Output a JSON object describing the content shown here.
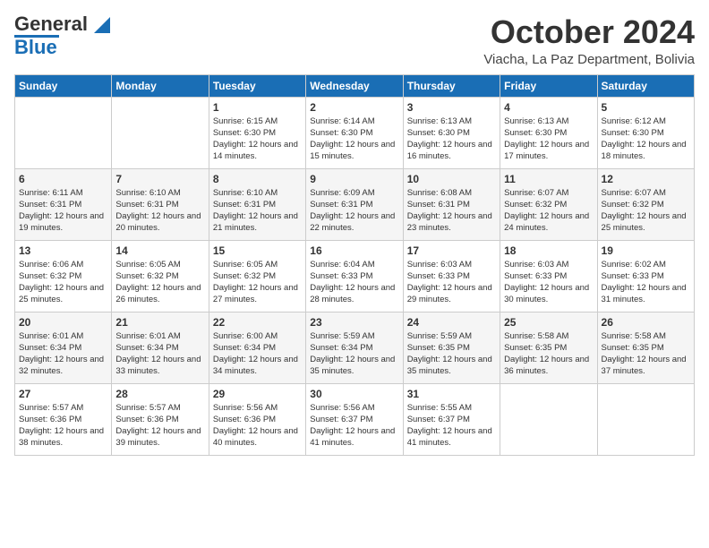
{
  "header": {
    "logo_general": "General",
    "logo_blue": "Blue",
    "month": "October 2024",
    "location": "Viacha, La Paz Department, Bolivia"
  },
  "days_of_week": [
    "Sunday",
    "Monday",
    "Tuesday",
    "Wednesday",
    "Thursday",
    "Friday",
    "Saturday"
  ],
  "weeks": [
    [
      {
        "day": "",
        "sunrise": "",
        "sunset": "",
        "daylight": ""
      },
      {
        "day": "",
        "sunrise": "",
        "sunset": "",
        "daylight": ""
      },
      {
        "day": "1",
        "sunrise": "Sunrise: 6:15 AM",
        "sunset": "Sunset: 6:30 PM",
        "daylight": "Daylight: 12 hours and 14 minutes."
      },
      {
        "day": "2",
        "sunrise": "Sunrise: 6:14 AM",
        "sunset": "Sunset: 6:30 PM",
        "daylight": "Daylight: 12 hours and 15 minutes."
      },
      {
        "day": "3",
        "sunrise": "Sunrise: 6:13 AM",
        "sunset": "Sunset: 6:30 PM",
        "daylight": "Daylight: 12 hours and 16 minutes."
      },
      {
        "day": "4",
        "sunrise": "Sunrise: 6:13 AM",
        "sunset": "Sunset: 6:30 PM",
        "daylight": "Daylight: 12 hours and 17 minutes."
      },
      {
        "day": "5",
        "sunrise": "Sunrise: 6:12 AM",
        "sunset": "Sunset: 6:30 PM",
        "daylight": "Daylight: 12 hours and 18 minutes."
      }
    ],
    [
      {
        "day": "6",
        "sunrise": "Sunrise: 6:11 AM",
        "sunset": "Sunset: 6:31 PM",
        "daylight": "Daylight: 12 hours and 19 minutes."
      },
      {
        "day": "7",
        "sunrise": "Sunrise: 6:10 AM",
        "sunset": "Sunset: 6:31 PM",
        "daylight": "Daylight: 12 hours and 20 minutes."
      },
      {
        "day": "8",
        "sunrise": "Sunrise: 6:10 AM",
        "sunset": "Sunset: 6:31 PM",
        "daylight": "Daylight: 12 hours and 21 minutes."
      },
      {
        "day": "9",
        "sunrise": "Sunrise: 6:09 AM",
        "sunset": "Sunset: 6:31 PM",
        "daylight": "Daylight: 12 hours and 22 minutes."
      },
      {
        "day": "10",
        "sunrise": "Sunrise: 6:08 AM",
        "sunset": "Sunset: 6:31 PM",
        "daylight": "Daylight: 12 hours and 23 minutes."
      },
      {
        "day": "11",
        "sunrise": "Sunrise: 6:07 AM",
        "sunset": "Sunset: 6:32 PM",
        "daylight": "Daylight: 12 hours and 24 minutes."
      },
      {
        "day": "12",
        "sunrise": "Sunrise: 6:07 AM",
        "sunset": "Sunset: 6:32 PM",
        "daylight": "Daylight: 12 hours and 25 minutes."
      }
    ],
    [
      {
        "day": "13",
        "sunrise": "Sunrise: 6:06 AM",
        "sunset": "Sunset: 6:32 PM",
        "daylight": "Daylight: 12 hours and 25 minutes."
      },
      {
        "day": "14",
        "sunrise": "Sunrise: 6:05 AM",
        "sunset": "Sunset: 6:32 PM",
        "daylight": "Daylight: 12 hours and 26 minutes."
      },
      {
        "day": "15",
        "sunrise": "Sunrise: 6:05 AM",
        "sunset": "Sunset: 6:32 PM",
        "daylight": "Daylight: 12 hours and 27 minutes."
      },
      {
        "day": "16",
        "sunrise": "Sunrise: 6:04 AM",
        "sunset": "Sunset: 6:33 PM",
        "daylight": "Daylight: 12 hours and 28 minutes."
      },
      {
        "day": "17",
        "sunrise": "Sunrise: 6:03 AM",
        "sunset": "Sunset: 6:33 PM",
        "daylight": "Daylight: 12 hours and 29 minutes."
      },
      {
        "day": "18",
        "sunrise": "Sunrise: 6:03 AM",
        "sunset": "Sunset: 6:33 PM",
        "daylight": "Daylight: 12 hours and 30 minutes."
      },
      {
        "day": "19",
        "sunrise": "Sunrise: 6:02 AM",
        "sunset": "Sunset: 6:33 PM",
        "daylight": "Daylight: 12 hours and 31 minutes."
      }
    ],
    [
      {
        "day": "20",
        "sunrise": "Sunrise: 6:01 AM",
        "sunset": "Sunset: 6:34 PM",
        "daylight": "Daylight: 12 hours and 32 minutes."
      },
      {
        "day": "21",
        "sunrise": "Sunrise: 6:01 AM",
        "sunset": "Sunset: 6:34 PM",
        "daylight": "Daylight: 12 hours and 33 minutes."
      },
      {
        "day": "22",
        "sunrise": "Sunrise: 6:00 AM",
        "sunset": "Sunset: 6:34 PM",
        "daylight": "Daylight: 12 hours and 34 minutes."
      },
      {
        "day": "23",
        "sunrise": "Sunrise: 5:59 AM",
        "sunset": "Sunset: 6:34 PM",
        "daylight": "Daylight: 12 hours and 35 minutes."
      },
      {
        "day": "24",
        "sunrise": "Sunrise: 5:59 AM",
        "sunset": "Sunset: 6:35 PM",
        "daylight": "Daylight: 12 hours and 35 minutes."
      },
      {
        "day": "25",
        "sunrise": "Sunrise: 5:58 AM",
        "sunset": "Sunset: 6:35 PM",
        "daylight": "Daylight: 12 hours and 36 minutes."
      },
      {
        "day": "26",
        "sunrise": "Sunrise: 5:58 AM",
        "sunset": "Sunset: 6:35 PM",
        "daylight": "Daylight: 12 hours and 37 minutes."
      }
    ],
    [
      {
        "day": "27",
        "sunrise": "Sunrise: 5:57 AM",
        "sunset": "Sunset: 6:36 PM",
        "daylight": "Daylight: 12 hours and 38 minutes."
      },
      {
        "day": "28",
        "sunrise": "Sunrise: 5:57 AM",
        "sunset": "Sunset: 6:36 PM",
        "daylight": "Daylight: 12 hours and 39 minutes."
      },
      {
        "day": "29",
        "sunrise": "Sunrise: 5:56 AM",
        "sunset": "Sunset: 6:36 PM",
        "daylight": "Daylight: 12 hours and 40 minutes."
      },
      {
        "day": "30",
        "sunrise": "Sunrise: 5:56 AM",
        "sunset": "Sunset: 6:37 PM",
        "daylight": "Daylight: 12 hours and 41 minutes."
      },
      {
        "day": "31",
        "sunrise": "Sunrise: 5:55 AM",
        "sunset": "Sunset: 6:37 PM",
        "daylight": "Daylight: 12 hours and 41 minutes."
      },
      {
        "day": "",
        "sunrise": "",
        "sunset": "",
        "daylight": ""
      },
      {
        "day": "",
        "sunrise": "",
        "sunset": "",
        "daylight": ""
      }
    ]
  ]
}
